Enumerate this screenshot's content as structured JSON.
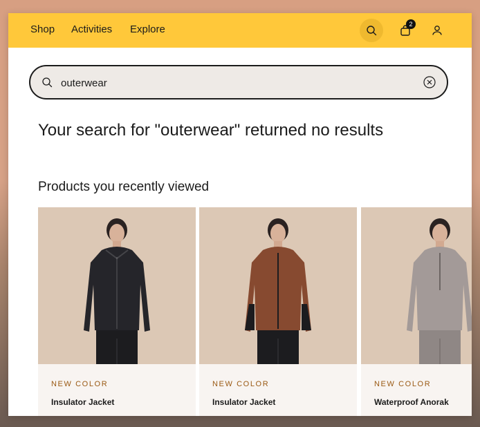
{
  "nav": {
    "links": [
      "Shop",
      "Activities",
      "Explore"
    ],
    "cart_count": "2"
  },
  "search": {
    "value": "outerwear",
    "placeholder": "Search"
  },
  "results": {
    "no_results_text": "Your search for \"outerwear\" returned no results"
  },
  "recent": {
    "title": "Products you recently viewed",
    "products": [
      {
        "badge": "NEW COLOR",
        "name": "Insulator Jacket",
        "jacket_color": "#25252a"
      },
      {
        "badge": "NEW COLOR",
        "name": "Insulator Jacket",
        "jacket_color": "#874a30"
      },
      {
        "badge": "NEW COLOR",
        "name": "Waterproof Anorak",
        "jacket_color": "#a39a98"
      }
    ]
  },
  "colors": {
    "topbar": "#ffc83a",
    "badge_text": "#9a5a14",
    "search_bg": "#eeeae6"
  }
}
